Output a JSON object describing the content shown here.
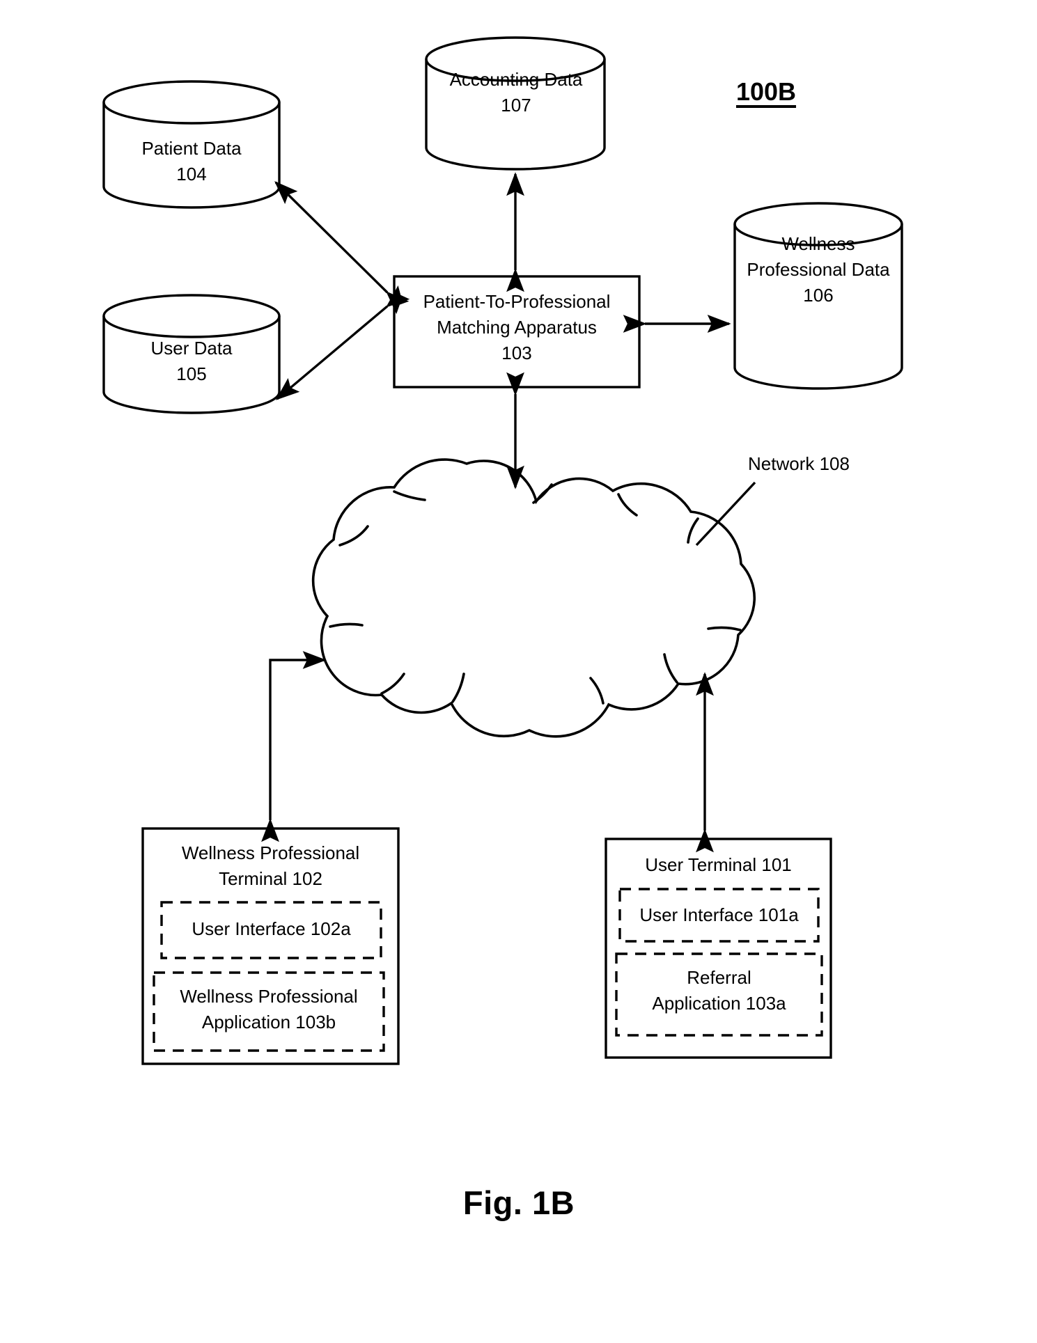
{
  "figure": {
    "caption": "Fig. 1B",
    "reference_numeral": "100B"
  },
  "colors": {
    "stroke": "#000000",
    "background": "#ffffff"
  },
  "datastores": [
    {
      "id": "patient-data",
      "name": "Patient Data",
      "numeral": "104",
      "label": "Patient Data\n104"
    },
    {
      "id": "accounting-data",
      "name": "Accounting Data",
      "numeral": "107",
      "label": "Accounting Data\n107"
    },
    {
      "id": "wellness-professional-data",
      "name": "Wellness Professional Data",
      "numeral": "106",
      "label": "Wellness\nProfessional Data\n106"
    },
    {
      "id": "user-data",
      "name": "User Data",
      "numeral": "105",
      "label": "User Data\n105"
    }
  ],
  "apparatus": {
    "id": "matching-apparatus",
    "name": "Patient-To-Professional Matching Apparatus",
    "numeral": "103",
    "label": "Patient-To-Professional\nMatching Apparatus\n103"
  },
  "network": {
    "id": "network-cloud",
    "label": "Network 108",
    "name": "Network",
    "numeral": "108"
  },
  "terminals": [
    {
      "id": "wellness-professional-terminal",
      "title": "Wellness Professional\nTerminal 102",
      "name": "Wellness Professional Terminal",
      "numeral": "102",
      "modules": [
        {
          "id": "ui-102a",
          "label": "User Interface 102a"
        },
        {
          "id": "wp-app-103b",
          "label": "Wellness Professional\nApplication 103b"
        }
      ]
    },
    {
      "id": "user-terminal",
      "title": "User Terminal 101",
      "name": "User Terminal",
      "numeral": "101",
      "modules": [
        {
          "id": "ui-101a",
          "label": "User Interface 101a"
        },
        {
          "id": "referral-app-103a",
          "label": "Referral\nApplication 103a"
        }
      ]
    }
  ],
  "connectors": [
    {
      "id": "apparatus-patient-data",
      "from": "matching-apparatus",
      "to": "patient-data",
      "style": "double-arrow"
    },
    {
      "id": "apparatus-user-data",
      "from": "matching-apparatus",
      "to": "user-data",
      "style": "double-arrow"
    },
    {
      "id": "apparatus-accounting-data",
      "from": "matching-apparatus",
      "to": "accounting-data",
      "style": "double-arrow"
    },
    {
      "id": "apparatus-wellness-professional-data",
      "from": "matching-apparatus",
      "to": "wellness-professional-data",
      "style": "double-arrow"
    },
    {
      "id": "apparatus-network",
      "from": "matching-apparatus",
      "to": "network-cloud",
      "style": "double-arrow"
    },
    {
      "id": "wellness-terminal-network",
      "from": "network-cloud",
      "to": "wellness-professional-terminal",
      "style": "double-arrow"
    },
    {
      "id": "user-terminal-network",
      "from": "network-cloud",
      "to": "user-terminal",
      "style": "double-arrow"
    },
    {
      "id": "network-leader-line",
      "from": "network-label",
      "to": "network-cloud",
      "style": "leader"
    }
  ]
}
